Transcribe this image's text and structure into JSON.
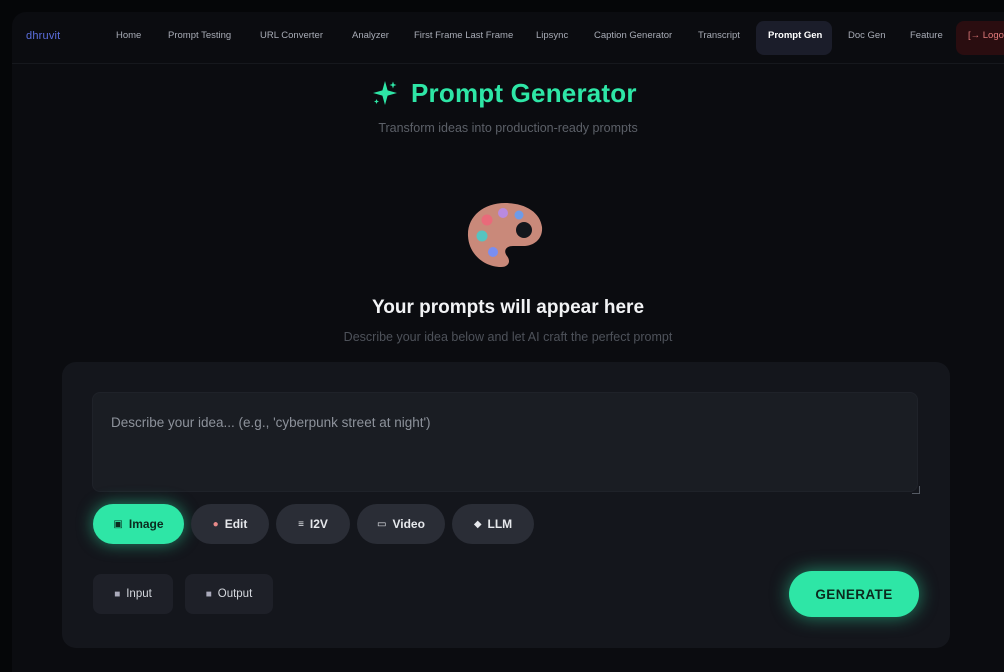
{
  "nav": {
    "brand": "dhruvit",
    "items": [
      {
        "label": "Home"
      },
      {
        "label": "Prompt Testing"
      },
      {
        "label": "URL Converter"
      },
      {
        "label": "Analyzer"
      },
      {
        "label": "First Frame Last Frame"
      },
      {
        "label": "Lipsync"
      },
      {
        "label": "Caption Generator"
      },
      {
        "label": "Transcript"
      },
      {
        "label": "Prompt Gen"
      },
      {
        "label": "Doc Gen"
      },
      {
        "label": "Feature"
      }
    ],
    "active_item": "Prompt Gen",
    "logout_label": "[→ Logo"
  },
  "header": {
    "icon": "sparkle-icon",
    "title": "Prompt Generator",
    "subtitle": "Transform ideas into production-ready prompts"
  },
  "empty_state": {
    "icon": "palette-icon",
    "title": "Your prompts will appear here",
    "subtitle": "Describe your idea below and let AI craft the perfect prompt"
  },
  "composer": {
    "placeholder": "Describe your idea... (e.g., 'cyberpunk street at night')",
    "value": "",
    "modes": [
      {
        "label": "Image",
        "icon": "image-icon",
        "active": true
      },
      {
        "label": "Edit",
        "icon": "palette-icon",
        "active": false
      },
      {
        "label": "I2V",
        "icon": "layers-icon",
        "active": false
      },
      {
        "label": "Video",
        "icon": "video-icon",
        "active": false
      },
      {
        "label": "LLM",
        "icon": "chat-icon",
        "active": false
      }
    ],
    "input_label": "Input",
    "output_label": "Output",
    "generate_label": "GENERATE"
  },
  "colors": {
    "accent": "#2ee6a6",
    "background": "#0b0c10",
    "card": "#14161c",
    "brand": "#5c6fe0"
  }
}
